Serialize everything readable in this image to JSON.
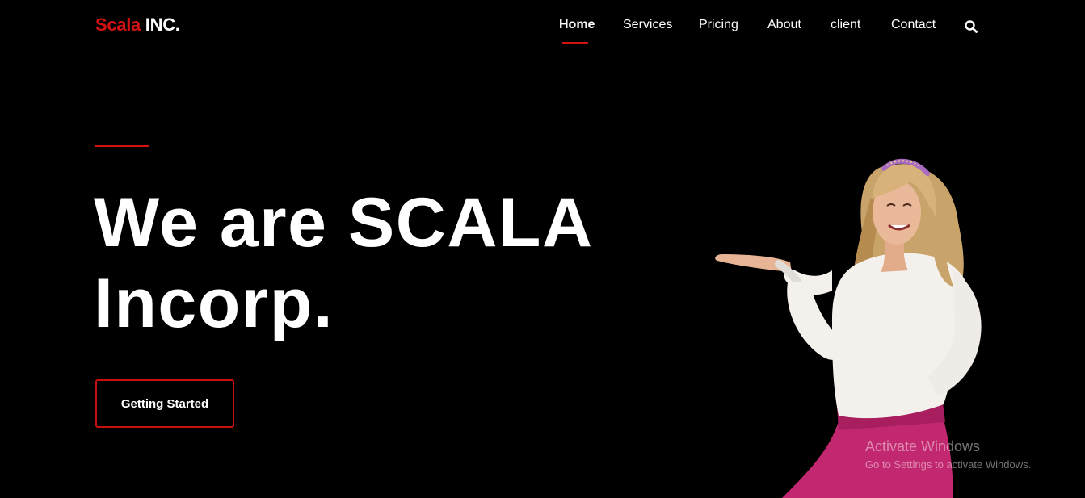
{
  "header": {
    "logo": {
      "brand": "Scala",
      "suffix": " INC."
    },
    "nav": [
      {
        "label": "Home",
        "active": true
      },
      {
        "label": "Services",
        "active": false
      },
      {
        "label": "Pricing",
        "active": false
      },
      {
        "label": "About",
        "active": false
      },
      {
        "label": "client",
        "active": false
      },
      {
        "label": "Contact",
        "active": false
      }
    ],
    "search_icon": "search-icon"
  },
  "hero": {
    "title_line1": "We are SCALA",
    "title_line2": "Incorp.",
    "cta_label": "Getting Started",
    "image": "woman-presenting-photo"
  },
  "watermark": {
    "title": "Activate Windows",
    "subtitle": "Go to Settings to activate Windows."
  },
  "colors": {
    "background": "#000000",
    "accent": "#d01212",
    "text": "#ffffff"
  }
}
